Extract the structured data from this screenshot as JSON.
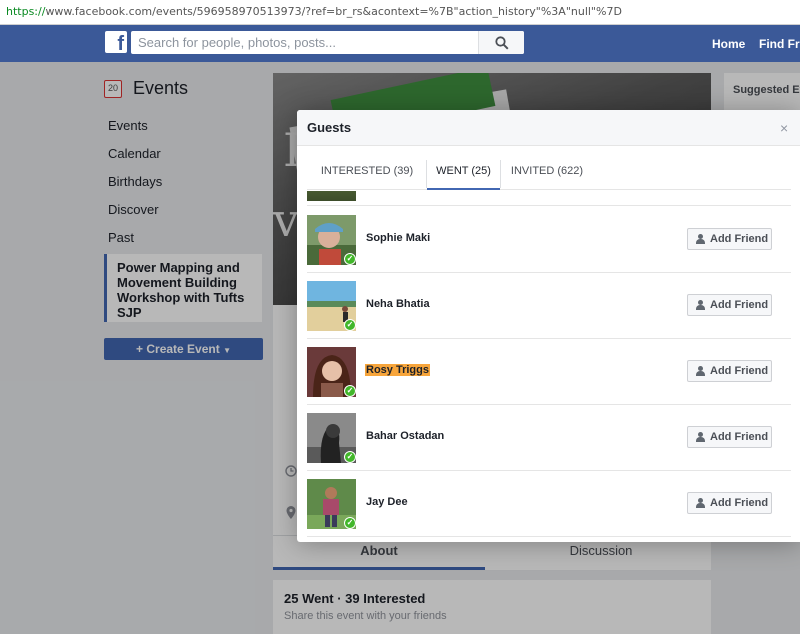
{
  "browser": {
    "url_scheme": "https://",
    "url_rest": "www.facebook.com/events/596958970513973/?ref=br_rs&acontext=%7B\"action_history\"%3A\"null\"%7D"
  },
  "header": {
    "logo": "f",
    "search_placeholder": "Search for people, photos, posts...",
    "nav_home": "Home",
    "nav_find_friends": "Find Frie"
  },
  "leftnav": {
    "calendar_day": "20",
    "title": "Events",
    "items": [
      "Events",
      "Calendar",
      "Birthdays",
      "Discover",
      "Past"
    ],
    "current_event": "Power Mapping and Movement Building Workshop with Tufts SJP",
    "create_button": "Create Event"
  },
  "cover": {
    "text1": "I",
    "text2": "ve"
  },
  "event_tabs": {
    "about": "About",
    "discussion": "Discussion"
  },
  "summary": {
    "counts": "25 Went · 39 Interested",
    "share": "Share this event with your friends"
  },
  "rightcol": {
    "suggested": "Suggested Ev"
  },
  "modal": {
    "title": "Guests",
    "close": "×",
    "tabs": [
      {
        "label": "INTERESTED (39)"
      },
      {
        "label": "WENT (25)"
      },
      {
        "label": "INVITED (622)"
      }
    ],
    "guests": [
      {
        "name": "Sophie Maki",
        "action": "Add Friend"
      },
      {
        "name": "Neha Bhatia",
        "action": "Add Friend"
      },
      {
        "name": "Rosy Triggs",
        "action": "Add Friend",
        "highlighted": true
      },
      {
        "name": "Bahar Ostadan",
        "action": "Add Friend"
      },
      {
        "name": "Jay Dee",
        "action": "Add Friend"
      }
    ]
  },
  "colors": {
    "fb_blue": "#3b5998",
    "button_blue": "#4267b2",
    "went_check": "#42b72a",
    "highlight": "#f7a53b"
  }
}
